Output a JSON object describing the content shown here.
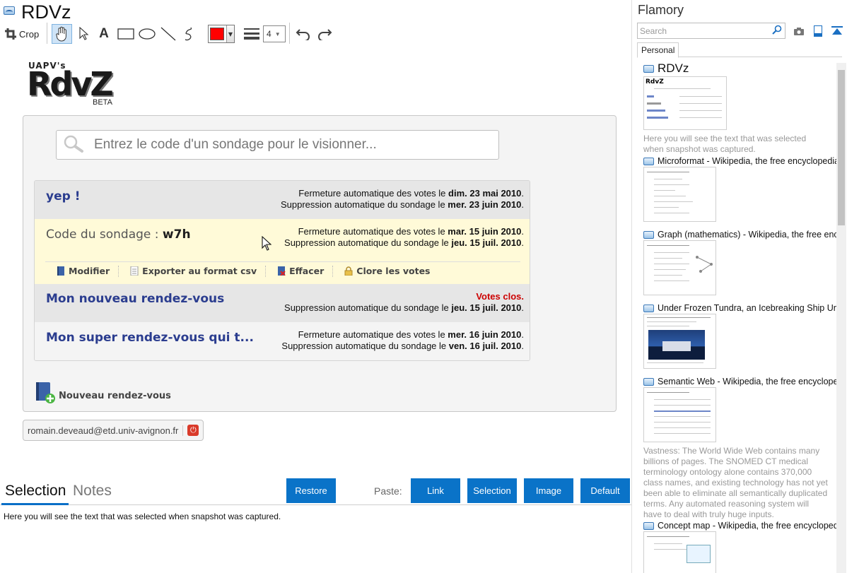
{
  "app": {
    "doc_title": "RDVz"
  },
  "toolbar": {
    "crop_label": "Crop",
    "stroke_width": "4",
    "color": "#ff0000"
  },
  "rdvz": {
    "logo_prefix": "UAPV's",
    "logo_text": "RdvZ",
    "logo_beta": "BETA",
    "search_placeholder": "Entrez le code d'un sondage pour le visionner...",
    "polls": [
      {
        "title": "yep !",
        "line1_prefix": "Fermeture automatique des votes le ",
        "line1_date": "dim. 23 mai 2010",
        "line2_prefix": "Suppression automatique du sondage le ",
        "line2_date": "mer. 23 juin 2010"
      },
      {
        "code_label": "Code du sondage : ",
        "code_value": "w7h",
        "line1_prefix": "Fermeture automatique des votes le ",
        "line1_date": "mar. 15 juin 2010",
        "line2_prefix": "Suppression automatique du sondage le ",
        "line2_date": "jeu. 15 juil. 2010",
        "actions": [
          "Modifier",
          "Exporter au format csv",
          "Effacer",
          "Clore les votes"
        ]
      },
      {
        "title": "Mon nouveau rendez-vous",
        "status": "Votes clos.",
        "line2_prefix": "Suppression automatique du sondage le ",
        "line2_date": "jeu. 15 juil. 2010"
      },
      {
        "title": "Mon super rendez-vous qui t...",
        "line1_prefix": "Fermeture automatique des votes le ",
        "line1_date": "mer. 16 juin 2010",
        "line2_prefix": "Suppression automatique du sondage le ",
        "line2_date": "ven. 16 juil. 2010"
      }
    ],
    "new_rdv_label": "Nouveau rendez-vous",
    "user_email": "romain.deveaud@etd.univ-avignon.fr"
  },
  "bottom": {
    "tabs": [
      "Selection",
      "Notes"
    ],
    "restore_label": "Restore",
    "paste_label": "Paste:",
    "paste_buttons": [
      "Link",
      "Selection",
      "Image",
      "Default"
    ],
    "selection_text": "Here you will see the text that was selected when snapshot was captured."
  },
  "flamory": {
    "title": "Flamory",
    "search_placeholder": "Search",
    "tab_personal": "Personal",
    "snapshots": [
      {
        "title": "RDVz",
        "desc": "Here you will see the text that was selected when snapshot was captured."
      },
      {
        "title": "Microformat - Wikipedia, the free encyclopedia"
      },
      {
        "title": "Graph (mathematics) - Wikipedia, the free ency"
      },
      {
        "title": "Under Frozen Tundra, an Icebreaking Ship Unco"
      },
      {
        "title": "Semantic Web - Wikipedia, the free encycloped",
        "desc": "Vastness: The World Wide Web contains many billions of pages. The SNOMED CT medical terminology ontology alone contains 370,000 class names, and existing technology has not yet been able to eliminate all semantically duplicated terms. Any automated reasoning system will have to deal with truly huge inputs."
      },
      {
        "title": "Concept map - Wikipedia, the free encyclopedi"
      }
    ]
  },
  "colors": {
    "accent": "#0a73c8",
    "rdvz_title": "#2b3d8f",
    "closed": "#cc0000"
  }
}
